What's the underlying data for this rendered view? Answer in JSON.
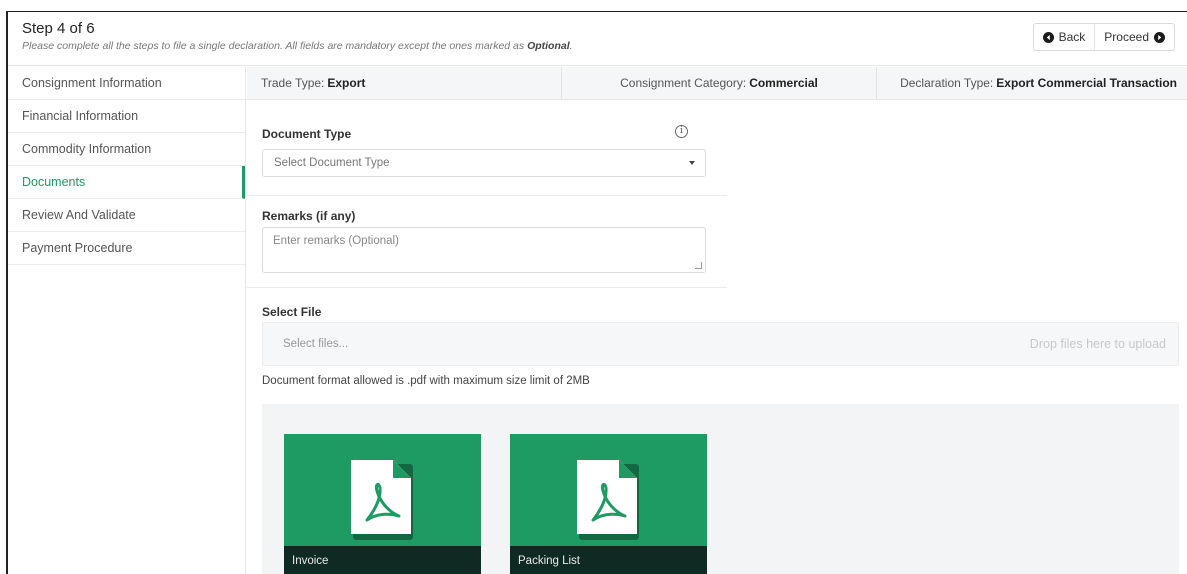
{
  "header": {
    "step": "Step 4 of 6",
    "subtitle_prefix": "Please complete all the steps to file a single declaration. All fields are mandatory except the ones marked as",
    "subtitle_emph": "Optional",
    "subtitle_suffix": ".",
    "back_label": "Back",
    "proceed_label": "Proceed"
  },
  "sidebar": {
    "items": [
      {
        "label": "Consignment Information"
      },
      {
        "label": "Financial Information"
      },
      {
        "label": "Commodity Information"
      },
      {
        "label": "Documents"
      },
      {
        "label": "Review And Validate"
      },
      {
        "label": "Payment Procedure"
      }
    ],
    "active_index": 3
  },
  "info_bar": {
    "trade_type_label": "Trade Type:",
    "trade_type_value": "Export",
    "category_label": "Consignment Category:",
    "category_value": "Commercial",
    "declaration_label": "Declaration Type:",
    "declaration_value": "Export Commercial Transaction"
  },
  "form": {
    "document_type_label": "Document Type",
    "document_type_placeholder": "Select Document Type",
    "remarks_label": "Remarks (if any)",
    "remarks_placeholder": "Enter remarks (Optional)",
    "select_file_label": "Select File",
    "select_files_button": "Select files...",
    "drop_hint": "Drop files here to upload",
    "format_note": "Document format allowed is .pdf with maximum size limit of 2MB"
  },
  "files": [
    {
      "name": "Invoice"
    },
    {
      "name": "Packing List"
    }
  ],
  "colors": {
    "accent": "#1e9b62",
    "caption_bg": "#0f2a22"
  },
  "icons": {
    "back": "circle-arrow-left-icon",
    "proceed": "circle-arrow-right-icon",
    "info": "info-icon",
    "file": "pdf-file-icon"
  }
}
